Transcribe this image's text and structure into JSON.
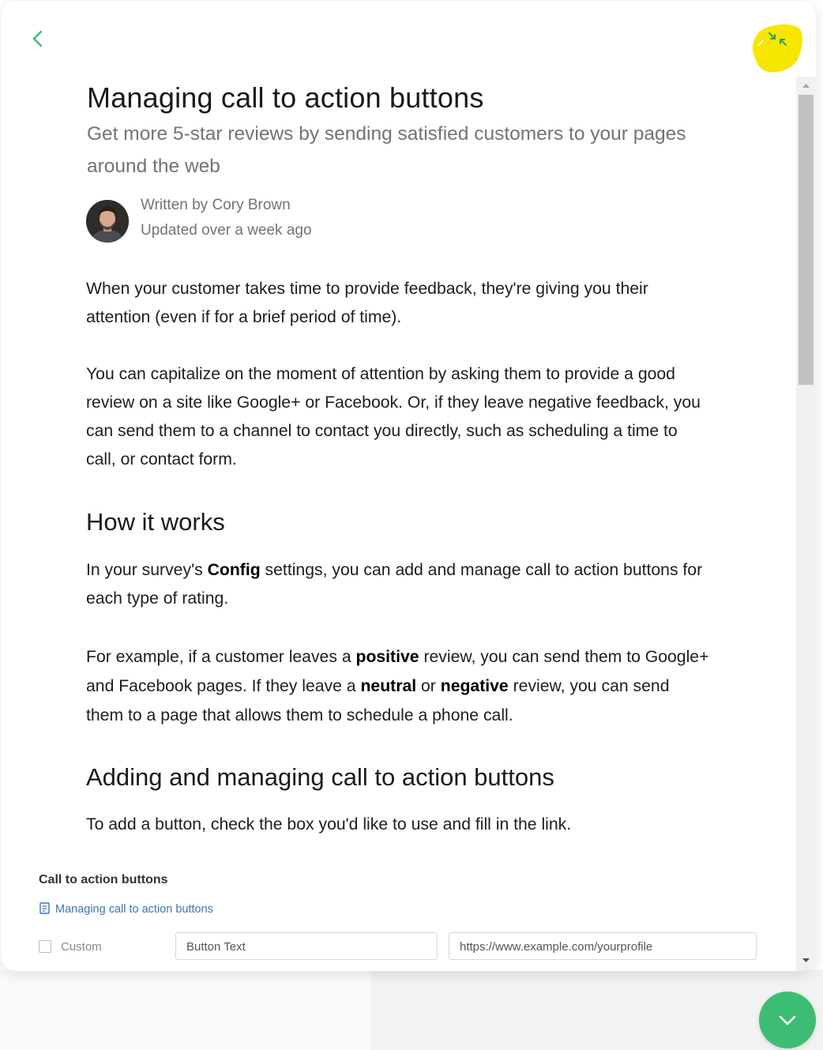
{
  "article": {
    "title": "Managing call to action buttons",
    "subtitle": "Get more 5-star reviews by sending satisfied customers to your pages around the web",
    "author_line": "Written by Cory Brown",
    "updated_line": "Updated over a week ago",
    "intro_p1": "When your customer takes time to provide feedback, they're giving you their attention (even if for a brief period of time).",
    "intro_p2": "You can capitalize on the moment of attention by asking them to provide a good review on a site like Google+ or Facebook. Or, if they leave negative feedback, you can send them to a channel to contact you directly, such as scheduling a time to call, or contact form.",
    "h_how": "How it works",
    "how_p1": {
      "a": "In your survey's ",
      "b": "Config",
      "c": " settings, you can add and manage call to action buttons for each type of rating."
    },
    "how_p2": {
      "a": "For example, if a customer leaves a ",
      "b": "positive",
      "c": " review, you can send them to Google+ and Facebook pages. If they leave a ",
      "d": "neutral",
      "e": " or ",
      "f": "negative",
      "g": " review, you can send them to a page that allows them to schedule a phone call."
    },
    "h_adding": "Adding and managing call to action buttons",
    "adding_p1": "To add a button, check the box you'd like to use and fill in the link."
  },
  "embedded_screenshot": {
    "section_title": "Call to action buttons",
    "doc_link": "Managing call to action buttons",
    "checkbox_label": "Custom",
    "button_text_placeholder": "Button Text",
    "url_placeholder": "https://www.example.com/yourprofile"
  },
  "icons": {
    "back": "chevron-left-icon",
    "collapse": "collapse-arrows-icon",
    "doc": "document-icon",
    "fab": "chevron-down-icon"
  },
  "colors": {
    "accent_green": "#3dbd73",
    "highlight_yellow": "#f7e600",
    "link_blue": "#3f73b8",
    "muted_text": "#737373"
  }
}
